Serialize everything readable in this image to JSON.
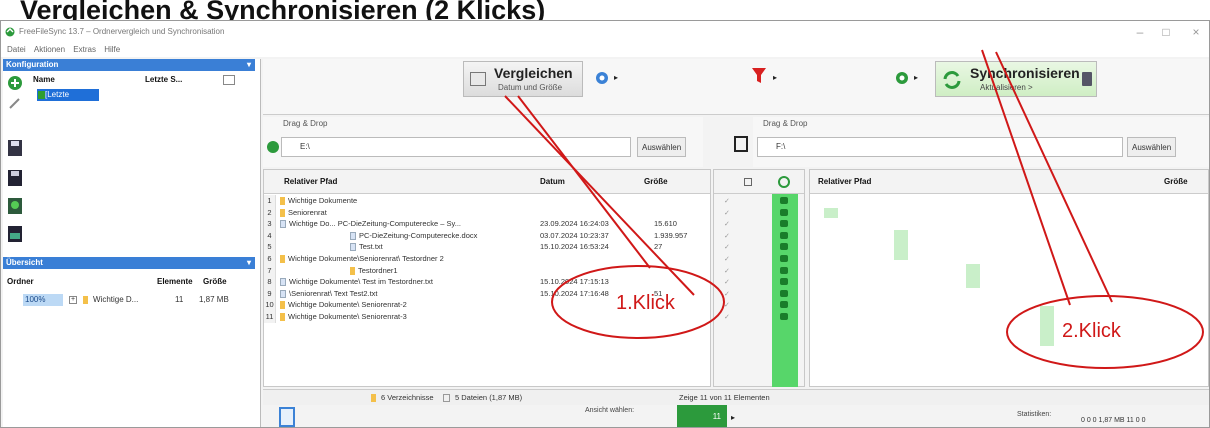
{
  "heading": "Vergleichen & Synchronisieren (2 Klicks)",
  "window": {
    "title": "FreeFileSync 13.7 – Ordnervergleich und Synchronisation",
    "controls": [
      "–",
      "□",
      "×"
    ]
  },
  "menu": [
    "Datei",
    "Aktionen",
    "Extras",
    "Hilfe"
  ],
  "left_panel": {
    "config_header": "Konfiguration",
    "config_columns": {
      "name": "Name",
      "last": "Letzte S..."
    },
    "config_selected": "[Letzte Sitzung]",
    "overview_header": "Übersicht",
    "overview_columns": {
      "folder": "Ordner",
      "elements": "Elemente",
      "size": "Größe"
    },
    "overview_row": {
      "percent": "100%",
      "name": "Wichtige D...",
      "elements": "11",
      "size": "1,87 MB"
    }
  },
  "toolbar": {
    "compare_label": "Vergleichen",
    "compare_sub": "Datum und Größe",
    "sync_label": "Synchronisieren",
    "sync_sub": "Aktualisieren >"
  },
  "folders": {
    "left": {
      "drag_label": "Drag & Drop",
      "path": "E:\\",
      "select": "Auswählen"
    },
    "right": {
      "drag_label": "Drag & Drop",
      "path": "F:\\",
      "select": "Auswählen"
    }
  },
  "grid": {
    "headers": {
      "path": "Relativer Pfad",
      "date": "Datum",
      "size": "Größe"
    },
    "rows": [
      {
        "n": "1",
        "path": "Wichtige Dokumente",
        "type": "folder",
        "indent": 0,
        "date": "",
        "size": ""
      },
      {
        "n": "2",
        "path": "Seniorenrat",
        "type": "folder",
        "indent": 0,
        "date": "",
        "size": ""
      },
      {
        "n": "3",
        "path": "Wichtige Do... PC-DieZeitung-Computerecke – Sy...",
        "type": "file",
        "indent": 0,
        "date": "23.09.2024 16:24:03",
        "size": "15.610"
      },
      {
        "n": "4",
        "path": "PC-DieZeitung-Computerecke.docx",
        "type": "file",
        "indent": 1,
        "date": "03.07.2024 10:23:37",
        "size": "1.939.957"
      },
      {
        "n": "5",
        "path": "Test.txt",
        "type": "file",
        "indent": 1,
        "date": "15.10.2024 16:53:24",
        "size": "27"
      },
      {
        "n": "6",
        "path": "Wichtige Dokumente\\Seniorenrat\\ Testordner 2",
        "type": "folder",
        "indent": 0,
        "date": "",
        "size": ""
      },
      {
        "n": "7",
        "path": "Testordner1",
        "type": "folder",
        "indent": 1,
        "date": "",
        "size": ""
      },
      {
        "n": "8",
        "path": "Wichtige Dokumente\\ Test im Testordner.txt",
        "type": "file",
        "indent": 0,
        "date": "15.10.2024 17:15:13",
        "size": ""
      },
      {
        "n": "9",
        "path": "\\Seniorenrat\\ Text Test2.txt",
        "type": "file",
        "indent": 0,
        "date": "15.10.2024 17:16:48",
        "size": "51"
      },
      {
        "n": "10",
        "path": "Wichtige Dokumente\\ Seniorenrat-2",
        "type": "folder",
        "indent": 0,
        "date": "",
        "size": ""
      },
      {
        "n": "11",
        "path": "Wichtige Dokumente\\ Seniorenrat-3",
        "type": "folder",
        "indent": 0,
        "date": "",
        "size": ""
      }
    ]
  },
  "right_grid": {
    "headers": {
      "path": "Relativer Pfad",
      "size": "Größe"
    }
  },
  "status": {
    "dirs": "6 Verzeichnisse",
    "files": "5 Dateien (1,87 MB)",
    "shown": "Zeige 11 von 11 Elementen"
  },
  "bottom": {
    "view_label": "Ansicht wählen:",
    "count_badge": "11",
    "stats_label": "Statistiken:",
    "stats_values": "0  0  0  1,87 MB  11  0  0"
  },
  "annotations": {
    "first": "1.Klick",
    "second": "2.Klick",
    "color": "#d01818"
  }
}
